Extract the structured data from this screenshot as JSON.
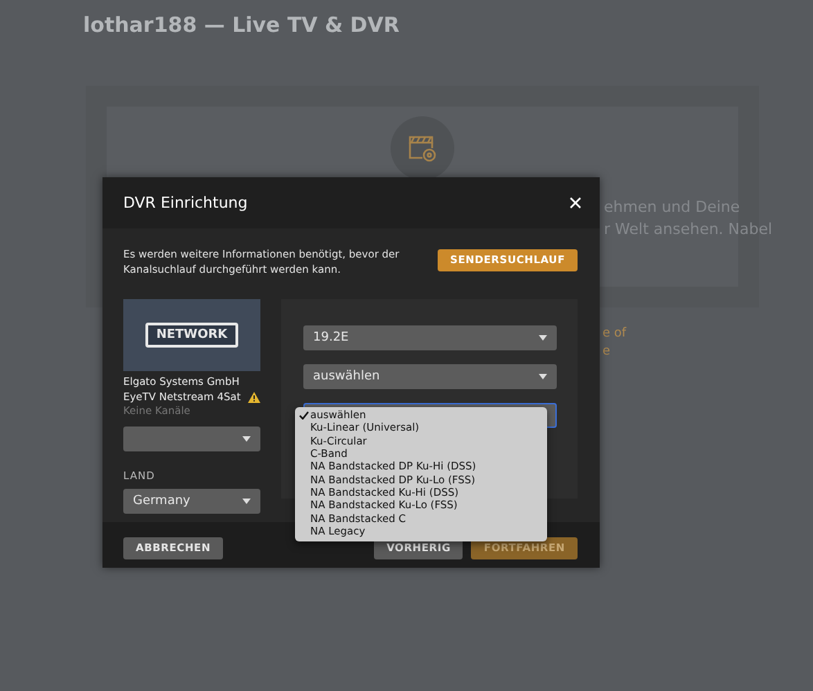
{
  "page": {
    "title": "lothar188 — Live TV & DVR",
    "background_texts": [
      "ehmen und Deine",
      "r Welt ansehen. Nabel"
    ],
    "background_links": [
      "e of",
      "e"
    ]
  },
  "dialog": {
    "title": "DVR Einrichtung",
    "message": "Es werden weitere Informationen benötigt, bevor der Kanalsuchlauf durchgeführt werden kann.",
    "scan_button": "SENDERSUCHLAUF",
    "device": {
      "badge": "NETWORK",
      "manufacturer": "Elgato Systems GmbH",
      "model": "EyeTV Netstream 4Sat",
      "warning": true,
      "channels": "Keine Kanäle"
    },
    "country": {
      "label": "LAND",
      "value": "Germany"
    },
    "selects": [
      {
        "value": "19.2E",
        "focused": false
      },
      {
        "value": "auswählen",
        "focused": false
      },
      {
        "focused": true
      }
    ],
    "dropdown": {
      "options": [
        {
          "label": "auswählen",
          "selected": true
        },
        {
          "label": "Ku-Linear (Universal)",
          "selected": false
        },
        {
          "label": "Ku-Circular",
          "selected": false
        },
        {
          "label": "C-Band",
          "selected": false
        },
        {
          "label": "NA Bandstacked DP Ku-Hi (DSS)",
          "selected": false
        },
        {
          "label": "NA Bandstacked DP Ku-Lo (FSS)",
          "selected": false
        },
        {
          "label": "NA Bandstacked Ku-Hi (DSS)",
          "selected": false
        },
        {
          "label": "NA Bandstacked Ku-Lo (FSS)",
          "selected": false
        },
        {
          "label": "NA Bandstacked C",
          "selected": false
        },
        {
          "label": "NA Legacy",
          "selected": false
        }
      ]
    },
    "buttons": [
      {
        "label": "ABBRECHEN",
        "kind": "secondary"
      },
      {
        "label": "VORHERIG",
        "kind": "secondary"
      },
      {
        "label": "FORTFAHREN",
        "kind": "primary"
      }
    ]
  }
}
